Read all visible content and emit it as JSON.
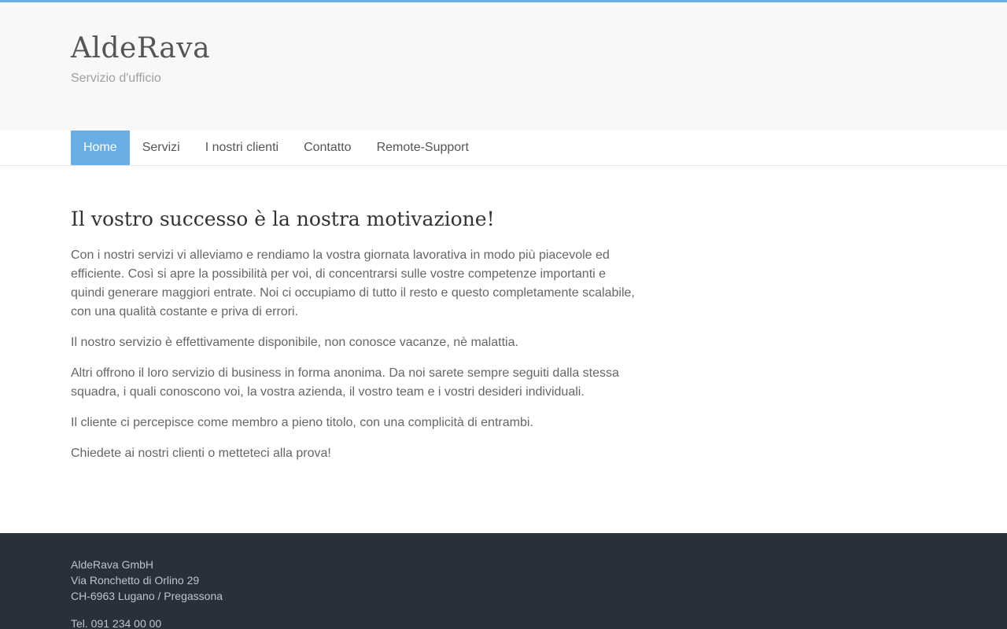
{
  "header": {
    "title": "AldeRava",
    "tagline": "Servizio d'ufficio"
  },
  "nav": {
    "items": [
      {
        "label": "Home",
        "active": true
      },
      {
        "label": "Servizi"
      },
      {
        "label": "I nostri clienti"
      },
      {
        "label": "Contatto"
      },
      {
        "label": "Remote-Support"
      }
    ]
  },
  "main": {
    "heading": "Il vostro successo è la nostra motivazione!",
    "paragraphs": [
      "Con i nostri servizi vi alleviamo e rendiamo la vostra giornata lavorativa in modo più piacevole ed efficiente. Così si apre la possibilità per voi, di concentrarsi sulle vostre competenze importanti e quindi generare maggiori entrate. Noi ci occupiamo di tutto il resto e questo completamente scalabile, con una qualità costante e priva di errori.",
      "Il nostro servizio è effettivamente disponibile, non conosce vacanze, nè malattia.",
      "Altri offrono il loro servizio di business in forma anonima. Da noi sarete sempre seguiti dalla stessa squadra, i quali conoscono voi, la vostra azienda, il vostro team e i vostri desideri individuali.",
      "Il cliente ci percepisce come membro a pieno titolo, con una complicità di entrambi.",
      "Chiedete ai nostri clienti o metteteci alla prova!"
    ]
  },
  "footer": {
    "company": "AldeRava GmbH",
    "street": "Via Ronchetto di Orlino 29",
    "city": "CH-6963 Lugano / Pregassona",
    "phone": "Tel. 091 234 00 00"
  },
  "colors": {
    "accent": "#6aaee6",
    "footer_bg": "#28303c",
    "header_bg": "#f8f8f8"
  }
}
